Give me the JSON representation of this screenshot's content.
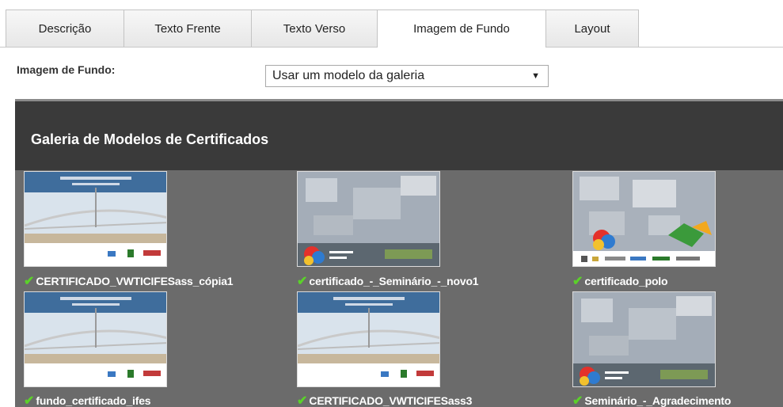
{
  "tabs": [
    {
      "label": "Descrição",
      "active": false
    },
    {
      "label": "Texto Frente",
      "active": false
    },
    {
      "label": "Texto Verso",
      "active": false
    },
    {
      "label": "Imagem de Fundo",
      "active": true
    },
    {
      "label": "Layout",
      "active": false
    }
  ],
  "form": {
    "background_label": "Imagem de Fundo:",
    "background_select_value": "Usar um modelo da galeria"
  },
  "gallery": {
    "title": "Galeria de Modelos de Certificados",
    "items": [
      {
        "name": "CERTIFICADO_VWTICIFESass_cópia1",
        "style": "bridge",
        "selected": true
      },
      {
        "name": "certificado_-_Seminário_-_novo1",
        "style": "aerial",
        "selected": true
      },
      {
        "name": "certificado_polo",
        "style": "aerial-logos",
        "selected": true
      },
      {
        "name": "fundo_certificado_ifes",
        "style": "bridge",
        "selected": true
      },
      {
        "name": "CERTIFICADO_VWTICIFESass3",
        "style": "bridge",
        "selected": true
      },
      {
        "name": "Seminário_-_Agradecimento",
        "style": "aerial",
        "selected": true
      }
    ]
  },
  "colors": {
    "checkmark": "#5bd12a",
    "gallery_header": "#3a3a3a",
    "gallery_bg": "#6b6b6b"
  }
}
